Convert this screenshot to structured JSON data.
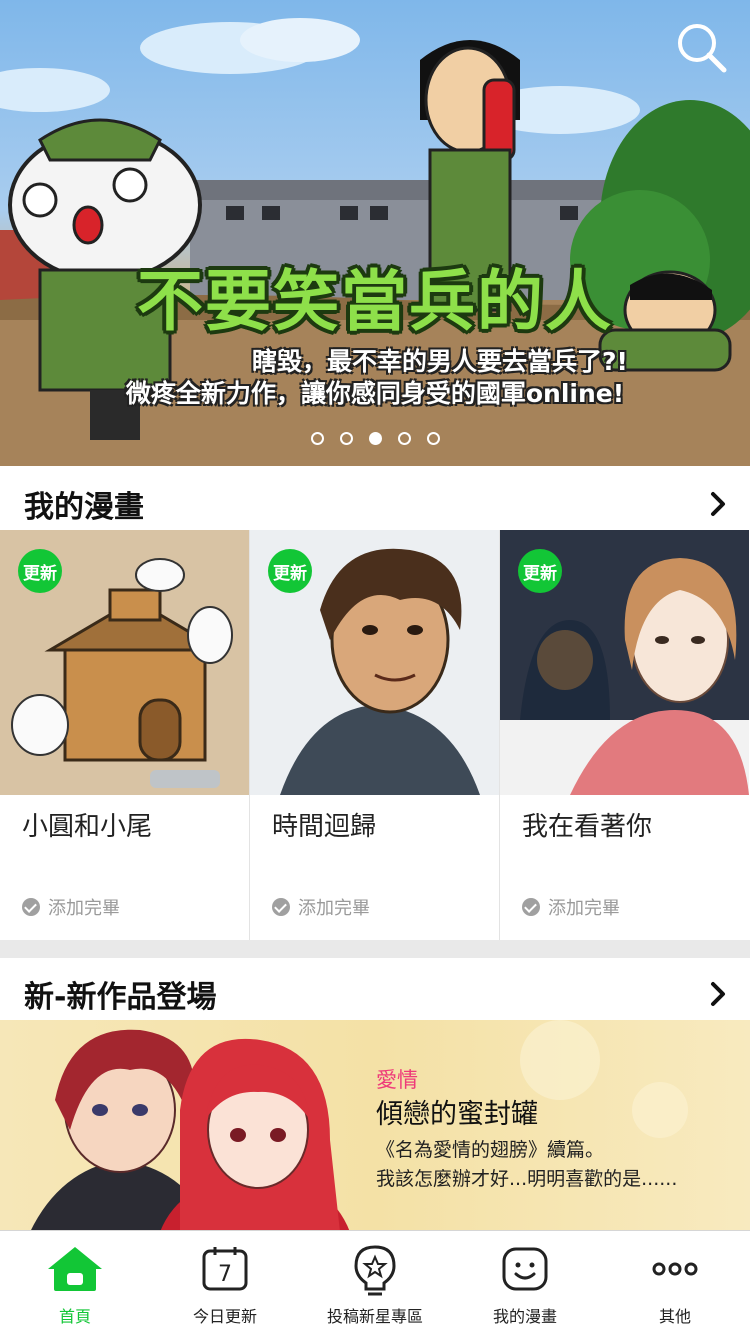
{
  "banner": {
    "title": "不要笑當兵的人",
    "subtitle_line1": "瞎毀，最不幸的男人要去當兵了?!",
    "subtitle_line2": "微疼全新力作，讓你感同身受的國軍online!",
    "slides": 5,
    "active_slide": 3
  },
  "my_comics": {
    "header": "我的漫畫",
    "items": [
      {
        "badge": "更新",
        "title": "小圓和小尾",
        "status": "添加完畢"
      },
      {
        "badge": "更新",
        "title": "時間迴歸",
        "status": "添加完畢"
      },
      {
        "badge": "更新",
        "title": "我在看著你",
        "status": "添加完畢"
      }
    ]
  },
  "new_works": {
    "header": "新-新作品登場",
    "feature": {
      "genre": "愛情",
      "title": "傾戀的蜜封罐",
      "desc_line1": "《名為愛情的翅膀》續篇。",
      "desc_line2": "我該怎麼辦才好...明明喜歡的是......"
    }
  },
  "tabbar": {
    "items": [
      {
        "label": "首頁",
        "icon": "home-icon",
        "active": true
      },
      {
        "label": "今日更新",
        "icon": "calendar-icon",
        "calendar_day": "7"
      },
      {
        "label": "投稿新星專區",
        "icon": "star-bulb-icon"
      },
      {
        "label": "我的漫畫",
        "icon": "smile-face-icon"
      },
      {
        "label": "其他",
        "icon": "more-dots-icon"
      }
    ]
  },
  "colors": {
    "accent_green": "#12c636",
    "genre_pink": "#ee3b7a"
  }
}
